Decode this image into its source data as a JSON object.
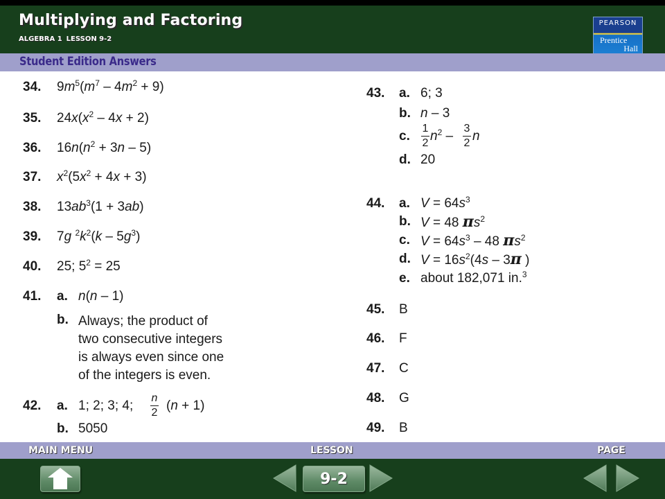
{
  "header": {
    "title": "Multiplying and Factoring",
    "subtitle_course": "ALGEBRA 1",
    "subtitle_lesson": "LESSON 9-2",
    "logo": {
      "line1": "PEARSON",
      "line2": "Prentice",
      "line3": "Hall"
    }
  },
  "band": {
    "label": "Student Edition Answers"
  },
  "answers": {
    "a34": {
      "num": "34."
    },
    "a35": {
      "num": "35."
    },
    "a36": {
      "num": "36."
    },
    "a37": {
      "num": "37."
    },
    "a38": {
      "num": "38."
    },
    "a39": {
      "num": "39."
    },
    "a40": {
      "num": "40.",
      "text": "25; 5",
      "sup": "2",
      "rest": " = 25"
    },
    "a41": {
      "num": "41.",
      "a_label": "a.",
      "b_label": "b.",
      "b_lines": [
        "Always; the product of",
        "two consecutive integers",
        "is always even since one",
        "of the integers is even."
      ]
    },
    "a42": {
      "num": "42.",
      "a_label": "a.",
      "a_text": "1; 2; 3; 4;",
      "b_label": "b.",
      "b_text": "5050"
    },
    "a43": {
      "num": "43.",
      "a_label": "a.",
      "a_text": "6; 3",
      "b_label": "b.",
      "c_label": "c.",
      "d_label": "d.",
      "d_text": "20"
    },
    "a44": {
      "num": "44.",
      "a_label": "a.",
      "b_label": "b.",
      "c_label": "c.",
      "d_label": "d.",
      "e_label": "e.",
      "e_text": "about 182,071 in.",
      "e_sup": "3"
    },
    "a45": {
      "num": "45.",
      "text": "B"
    },
    "a46": {
      "num": "46.",
      "text": "F"
    },
    "a47": {
      "num": "47.",
      "text": "C"
    },
    "a48": {
      "num": "48.",
      "text": "G"
    },
    "a49": {
      "num": "49.",
      "text": "B"
    }
  },
  "footer": {
    "main_menu_label": "MAIN MENU",
    "lesson_label": "LESSON",
    "page_label": "PAGE",
    "lesson_number": "9-2"
  },
  "colors": {
    "header_green": "#173f1c",
    "band_lavender": "#9f9fcb",
    "band_text": "#3a2a8a",
    "button_green": "#5e8a66"
  }
}
